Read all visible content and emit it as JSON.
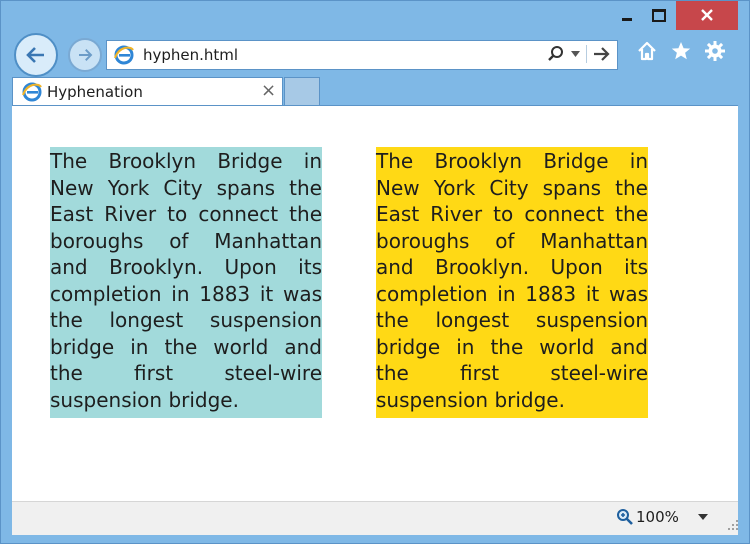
{
  "browser": {
    "address_url": "hyphen.html",
    "tab_title": "Hyphenation",
    "zoom_label": "100%"
  },
  "content": {
    "paragraph_left": "The Brooklyn Bridge in New York City spans the East River to connect the boroughs of Manhattan and Brooklyn. Upon its completion in 1883 it was the longest suspension bridge in the world and the first steel-wire suspension bridge.",
    "paragraph_right": "The Brooklyn Bridge in New York City spans the East River to connect the boroughs of Manhattan and Brooklyn. Upon its completion in 1883 it was the longest suspension bridge in the world and the first steel-wire suspension bridge."
  },
  "colors": {
    "frame": "#7fb8e6",
    "close_button": "#c7474b",
    "left_paragraph_bg": "#a2dadb",
    "right_paragraph_bg": "#ffd915"
  },
  "icons": [
    "back-arrow-icon",
    "forward-arrow-icon",
    "ie-logo-icon",
    "search-icon",
    "dropdown-icon",
    "go-arrow-icon",
    "home-icon",
    "favorites-star-icon",
    "settings-gear-icon",
    "close-tab-icon",
    "zoom-icon"
  ]
}
